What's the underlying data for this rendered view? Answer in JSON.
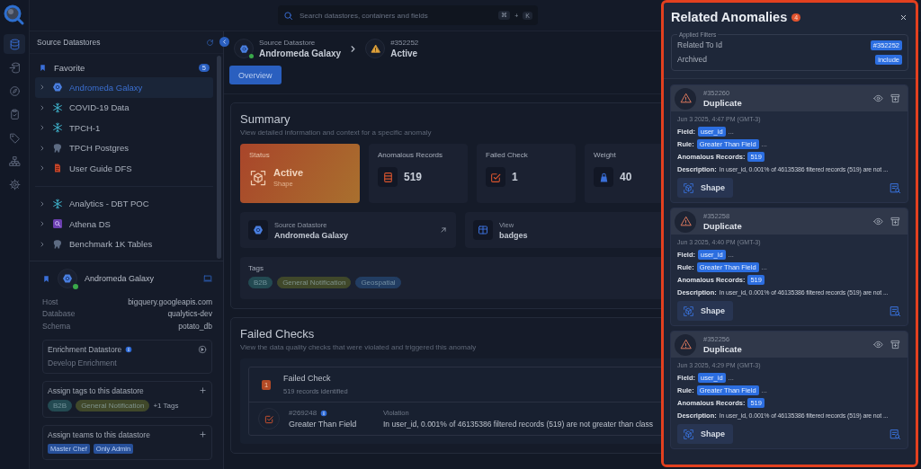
{
  "rail": [
    {
      "selected": true
    },
    {
      "selected": false
    },
    {
      "selected": false
    },
    {
      "selected": false
    },
    {
      "selected": false
    },
    {
      "selected": false
    },
    {
      "selected": false
    }
  ],
  "search": {
    "placeholder": "Search datastores, containers and fields",
    "shortcut": [
      {
        "key": "⌘",
        "kind": "key"
      },
      {
        "key": "+",
        "kind": "joiner"
      },
      {
        "key": "K",
        "kind": "key"
      }
    ]
  },
  "sidebar": {
    "title": "Source Datastores",
    "favorites": {
      "label": "Favorite",
      "count": "5",
      "items": [
        {
          "label": "Andromeda Galaxy",
          "kind": "bigquery",
          "selected": true
        },
        {
          "label": "COVID-19 Data",
          "kind": "snowflake",
          "selected": false
        },
        {
          "label": "TPCH-1",
          "kind": "snowflake",
          "selected": false
        },
        {
          "label": "TPCH Postgres",
          "kind": "postgres",
          "selected": false
        },
        {
          "label": "User Guide DFS",
          "kind": "dfs",
          "selected": false
        }
      ]
    },
    "items": [
      {
        "label": "Analytics - DBT POC",
        "kind": "snowflake",
        "selected": false
      },
      {
        "label": "Athena DS",
        "kind": "athena",
        "selected": false
      },
      {
        "label": "Benchmark 1K Tables",
        "kind": "postgres",
        "selected": false
      }
    ],
    "details": {
      "name": "Andromeda Galaxy",
      "kind": "bigquery",
      "online": true,
      "properties": [
        {
          "label": "Host",
          "value": "bigquery.googleapis.com"
        },
        {
          "label": "Database",
          "value": "qualytics-dev"
        },
        {
          "label": "Schema",
          "value": "potato_db"
        }
      ],
      "enrichment": {
        "title": "Enrichment Datastore",
        "value": "Develop Enrichment"
      },
      "tags": {
        "title": "Assign tags to this datastore",
        "items": [
          {
            "label": "B2B",
            "color": "#234a52"
          },
          {
            "label": "General Notification",
            "color": "#40482a"
          }
        ],
        "more": "+1 Tags"
      },
      "teams": {
        "title": "Assign teams to this datastore",
        "items": [
          "Master Chef",
          "Only Admin"
        ]
      }
    }
  },
  "breadcrumb": [
    {
      "caption": "Source Datastore",
      "title": "Andromeda Galaxy",
      "kind": "datastore",
      "online": true
    },
    {
      "caption": "#352252",
      "title": "Active",
      "kind": "anomaly"
    }
  ],
  "tabs": [
    {
      "label": "Overview",
      "selected": true
    }
  ],
  "summary": {
    "title": "Summary",
    "subtitle": "View detailed information and context for a specific anomaly",
    "stats": [
      {
        "kind": "status",
        "label": "Status",
        "value": "Active",
        "sub": "Shape"
      },
      {
        "kind": "records",
        "label": "Anomalous Records",
        "value": "519"
      },
      {
        "kind": "check",
        "label": "Failed Check",
        "value": "1"
      },
      {
        "kind": "weight",
        "label": "Weight",
        "value": "40"
      }
    ],
    "links": [
      {
        "kind": "datastore",
        "caption": "Source Datastore",
        "value": "Andromeda Galaxy"
      },
      {
        "kind": "view",
        "caption": "View",
        "value": "badges"
      }
    ],
    "tags": {
      "label": "Tags",
      "items": [
        {
          "label": "B2B",
          "color": "#234a52"
        },
        {
          "label": "General Notification",
          "color": "#40482a"
        },
        {
          "label": "Geospatial",
          "color": "#223d62"
        }
      ]
    }
  },
  "failed_checks": {
    "title": "Failed Checks",
    "subtitle": "View the data quality checks that were violated and triggered this anomaly",
    "group": {
      "count": "1",
      "title": "Failed Check",
      "subtitle": "519 records identified"
    },
    "checks": [
      {
        "id": "#269248",
        "name": "Greater Than Field",
        "violation_label": "Violation",
        "violation": "In user_id, 0.001% of 46135386 filtered records (519) are not greater than class"
      }
    ]
  },
  "panel": {
    "title": "Related Anomalies",
    "count": "4",
    "filters": {
      "legend": "Applied Filters",
      "items": [
        {
          "label": "Related To Id",
          "value": "#352252"
        },
        {
          "label": "Archived",
          "value": "include"
        }
      ]
    },
    "anomalies": [
      {
        "id": "#352260",
        "type": "Duplicate",
        "time": "Jun 3 2025, 4:47 PM (GMT-3)",
        "status": "Shape",
        "fields": [
          {
            "kind": "badge",
            "label": "Field:",
            "value": "user_id",
            "more": "..."
          },
          {
            "kind": "badge",
            "label": "Rule:",
            "value": "Greater Than Field",
            "more": "..."
          },
          {
            "kind": "badge",
            "label": "Anomalous Records:",
            "value": "519"
          },
          {
            "kind": "text",
            "label": "Description:",
            "value": "In user_id, 0.001% of 46135386 filtered records (519) are not ..."
          }
        ]
      },
      {
        "id": "#352258",
        "type": "Duplicate",
        "time": "Jun 3 2025, 4:40 PM (GMT-3)",
        "status": "Shape",
        "fields": [
          {
            "kind": "badge",
            "label": "Field:",
            "value": "user_id",
            "more": "..."
          },
          {
            "kind": "badge",
            "label": "Rule:",
            "value": "Greater Than Field",
            "more": "..."
          },
          {
            "kind": "badge",
            "label": "Anomalous Records:",
            "value": "519"
          },
          {
            "kind": "text",
            "label": "Description:",
            "value": "In user_id, 0.001% of 46135386 filtered records (519) are not ..."
          }
        ]
      },
      {
        "id": "#352256",
        "type": "Duplicate",
        "time": "Jun 3 2025, 4:29 PM (GMT-3)",
        "status": "Shape",
        "fields": [
          {
            "kind": "badge",
            "label": "Field:",
            "value": "user_id",
            "more": "..."
          },
          {
            "kind": "badge",
            "label": "Rule:",
            "value": "Greater Than Field",
            "more": "..."
          },
          {
            "kind": "badge",
            "label": "Anomalous Records:",
            "value": "519"
          },
          {
            "kind": "text",
            "label": "Description:",
            "value": "In user_id, 0.001% of 46135386 filtered records (519) are not ..."
          }
        ]
      }
    ]
  }
}
